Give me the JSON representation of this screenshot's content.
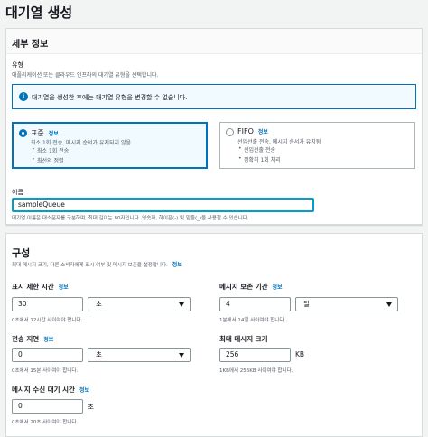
{
  "page_title": "대기열 생성",
  "details": {
    "title": "세부 정보",
    "type_label": "유형",
    "type_desc": "애플리케이션 또는 클라우드 인프라의 대기열 유형을 선택합니다.",
    "alert_icon": "info-icon",
    "alert_text": "대기열을 생성한 후에는 대기열 유형을 변경할 수 없습니다.",
    "standard": {
      "title": "표준",
      "info": "정보",
      "desc": "최소 1회 전송, 메시지 순서가 유지되지 않음",
      "bullets": [
        "최소 1회 전송",
        "최선의 정렬"
      ],
      "selected": true
    },
    "fifo": {
      "title": "FIFO",
      "info": "정보",
      "desc": "선입선출 전송, 메시지 순서가 유지됨",
      "bullets": [
        "선입선출 전송",
        "정확히 1회 처리"
      ],
      "selected": false
    },
    "name_label": "이름",
    "name_value": "sampleQueue",
    "name_hint": "대기열 이름은 대소문자를 구분하며, 최대 길이는 80자입니다. 영숫자, 하이픈(-) 및 밑줄(_)을 사용할 수 있습니다."
  },
  "config": {
    "title": "구성",
    "desc": "최대 메시지 크기, 다른 소비자에게 표시 여부 및 메시지 보존을 설정합니다.",
    "info": "정보",
    "visibility_timeout": {
      "label": "표시 제한 시간",
      "info": "정보",
      "value": "30",
      "unit": "초",
      "hint": "0초에서 12시간 사이여야 합니다."
    },
    "retention": {
      "label": "메시지 보존 기간",
      "info": "정보",
      "value": "4",
      "unit": "일",
      "hint": "1분에서 14일 사이여야 합니다."
    },
    "delivery_delay": {
      "label": "전송 지연",
      "info": "정보",
      "value": "0",
      "unit": "초",
      "hint": "0초에서 15분 사이여야 합니다."
    },
    "max_size": {
      "label": "최대 메시지 크기",
      "value": "256",
      "unit": "KB",
      "hint": "1KB에서 256KB 사이여야 합니다."
    },
    "receive_wait": {
      "label": "메시지 수신 대기 시간",
      "info": "정보",
      "value": "0",
      "unit": "초",
      "hint": "0초에서 20초 사이여야 합니다."
    }
  }
}
